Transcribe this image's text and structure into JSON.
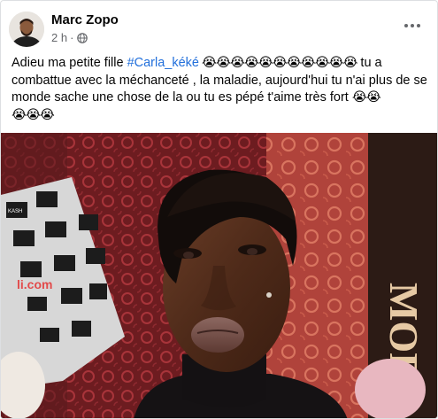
{
  "post": {
    "author": "Marc Zopo",
    "time": "2 h",
    "separator": "·",
    "privacy_icon": "globe-icon",
    "more_icon": "more-options-icon",
    "text": {
      "intro": "Adieu ma petite fille ",
      "hashtag": "#Carla_kéké",
      "emojis_line1": " 😭😭😭😭😭😭😭😭😭😭😭",
      "body": " tu a combattue avec la méchanceté , la maladie, aujourd'hui tu n'ai plus de se monde sache une chose de la ou tu es pépé t'aime très fort ",
      "emojis_end": "😭😭",
      "emojis_line4": " 😭😭😭"
    },
    "photo_icon": "portrait-photo",
    "photo_text": {
      "backdrop_brand": "KASH",
      "backdrop_url": "li.com",
      "sign_letters": "MOE"
    }
  },
  "colors": {
    "hashtag": "#216fdb",
    "meta": "#65676b",
    "text": "#050505"
  }
}
